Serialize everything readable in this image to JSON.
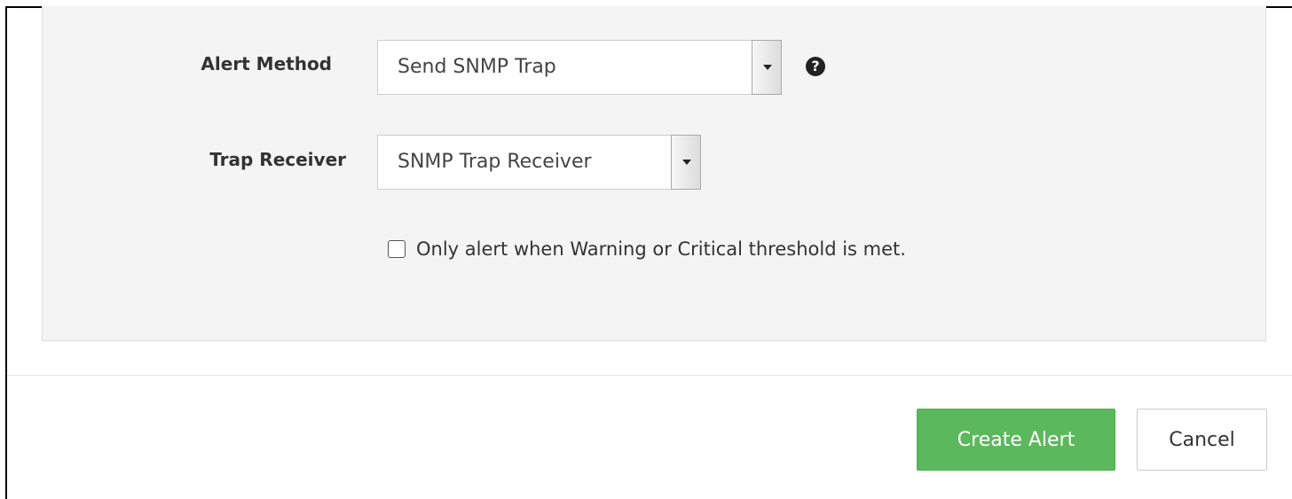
{
  "form": {
    "alert_method": {
      "label": "Alert Method",
      "value": "Send SNMP Trap",
      "help_icon": "question-circle-icon"
    },
    "trap_receiver": {
      "label": "Trap Receiver",
      "value": "SNMP Trap Receiver"
    },
    "threshold_checkbox": {
      "label": "Only alert when Warning or Critical threshold is met.",
      "checked": false
    }
  },
  "footer": {
    "create_label": "Create Alert",
    "cancel_label": "Cancel"
  },
  "colors": {
    "panel_bg": "#f4f4f4",
    "primary_button": "#5cb85c"
  }
}
